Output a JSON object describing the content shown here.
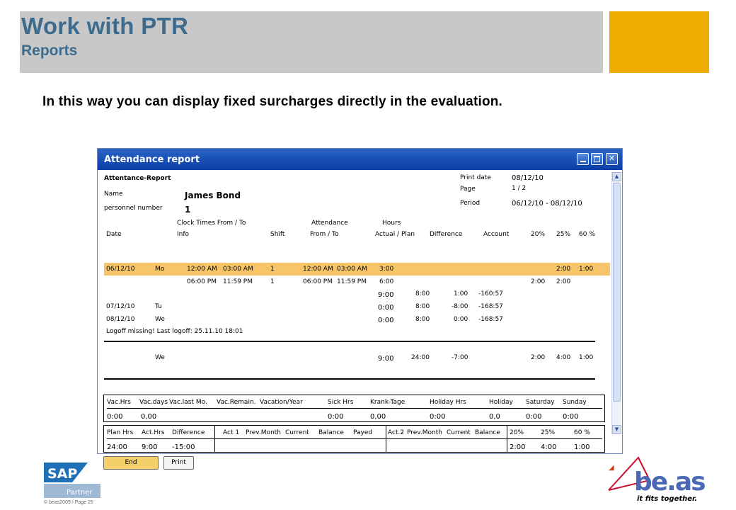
{
  "slide": {
    "title": "Work with PTR",
    "subtitle": "Reports",
    "lead": "In this way you can display fixed surcharges directly in the evaluation.",
    "footer_copyright": "© beas2009 / Page 25",
    "sap_logo_text": "SAP",
    "sap_partner_text": "Partner",
    "beas_logo_text": "be.as",
    "beas_tagline": "it fits together.",
    "colors": {
      "title": "#3d6b8e",
      "header_grey": "#c8c8c8",
      "header_gold": "#f0ab00",
      "highlight": "#f6c56a"
    }
  },
  "window": {
    "title": "Attendance report",
    "report_title": "Attentance-Report",
    "print_date_label": "Print date",
    "print_date": "08/12/10",
    "page_label": "Page",
    "page": "1 / 2",
    "period_label": "Period",
    "period": "06/12/10 - 08/12/10",
    "name_label": "Name",
    "name": "James Bond",
    "personnel_label": "personnel number",
    "personnel_number": "1",
    "groups": {
      "clock": "Clock Times From / To",
      "attendance": "Attendance",
      "hours": "Hours"
    },
    "columns": [
      "Date",
      "Info",
      "Shift",
      "From / To",
      "Actual / Plan",
      "Difference",
      "Account",
      "20%",
      "25%",
      "60 %"
    ],
    "rows": [
      {
        "date": "06/12/10",
        "day": "Mo",
        "clock_from": "12:00 AM",
        "clock_to": "03:00 AM",
        "shift": "1",
        "att_from": "12:00 AM",
        "att_to": "03:00 AM",
        "actual": "3:00",
        "p25": "2:00",
        "p60": "1:00"
      },
      {
        "clock_from": "06:00 PM",
        "clock_to": "11:59 PM",
        "shift": "1",
        "att_from": "06:00 PM",
        "att_to": "11:59 PM",
        "actual": "6:00",
        "p20": "2:00",
        "p25": "2:00"
      },
      {
        "actual": "9:00",
        "plan": "8:00",
        "difference": "1:00",
        "account": "-160:57"
      },
      {
        "date": "07/12/10",
        "day": "Tu",
        "actual": "0:00",
        "plan": "8:00",
        "difference": "-8:00",
        "account": "-168:57"
      },
      {
        "date": "08/12/10",
        "day": "We",
        "actual": "0:00",
        "plan": "8:00",
        "difference": "0:00",
        "account": "-168:57"
      }
    ],
    "logoff_note": "Logoff missing! Last logoff: 25.11.10 18:01",
    "total": {
      "day": "We",
      "actual": "9:00",
      "plan": "24:00",
      "difference": "-7:00",
      "p20": "2:00",
      "p25": "4:00",
      "p60": "1:00"
    },
    "summary1": {
      "headers": [
        "Vac.Hrs",
        "Vac.days",
        "Vac.last Mo.",
        "Vac.Remain.",
        "Vacation/Year",
        "Sick Hrs",
        "Krank-Tage",
        "Holiday Hrs",
        "Holiday",
        "Saturday",
        "Sunday"
      ],
      "values": [
        "0:00",
        "0,00",
        "0:00",
        "0,00",
        "0:00",
        "0,0",
        "0:00",
        "0:00"
      ]
    },
    "summary2": {
      "headers": [
        "Plan Hrs",
        "Act.Hrs",
        "Difference",
        "Act 1",
        "Prev.Month",
        "Current",
        "Balance",
        "Payed",
        "Act.2",
        "Prev.Month",
        "Current",
        "Balance",
        "20%",
        "25%",
        "60 %"
      ],
      "values": [
        "24:00",
        "9:00",
        "-15:00",
        "2:00",
        "4:00",
        "1:00"
      ]
    },
    "buttons": {
      "end": "End",
      "print": "Print"
    }
  }
}
